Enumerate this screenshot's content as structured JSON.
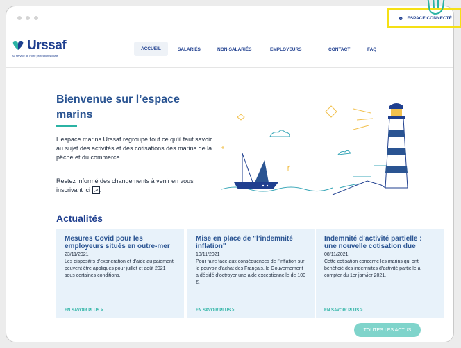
{
  "brand": {
    "name": "Urssaf",
    "tagline": "Au service de notre protection sociale"
  },
  "nav": {
    "items": [
      {
        "label": "ACCUEIL",
        "active": true
      },
      {
        "label": "SALARIÉS"
      },
      {
        "label": "NON-SALARIÉS"
      },
      {
        "label": "EMPLOYEURS"
      },
      {
        "label": "CONTACT"
      },
      {
        "label": "FAQ"
      }
    ],
    "espace": "ESPACE CONNECTÉ"
  },
  "hero": {
    "title": "Bienvenue sur l’espace marins",
    "intro": "L’espace marins Urssaf regroupe tout ce qu’il faut savoir au sujet des activités et des cotisations des marins de la pêche et du commerce.",
    "info_prefix": "Restez informé des changements à venir en vous ",
    "info_link": "inscrivant ici",
    "info_suffix": "."
  },
  "actus": {
    "title": "Actualités",
    "cards": [
      {
        "title": "Mesures Covid pour les employeurs situés en outre-mer",
        "date": "23/11/2021",
        "body": "Les dispositifs d’exonération et d’aide au paiement peuvent être appliqués pour juillet et août 2021 sous certaines conditions.",
        "link": "EN SAVOIR PLUS  >"
      },
      {
        "title": "Mise en place de \"l’indemnité inflation\"",
        "date": "10/11/2021",
        "body": "Pour faire face aux conséquences de l’inflation sur le pouvoir d’achat des Français, le Gouvernement a décidé d’octroyer une aide exceptionnelle de 100 €.",
        "link": "EN SAVOIR PLUS  >"
      },
      {
        "title": "Indemnité d’activité partielle : une nouvelle cotisation due",
        "date": "08/11/2021",
        "body": "Cette cotisation concerne les marins qui ont bénéficié des indemnités d’activité partielle à compter du 1er janvier 2021.",
        "link": "EN SAVOIR PLUS  >"
      }
    ],
    "all_button": "TOUTES LES ACTUS"
  },
  "colors": {
    "primary": "#1f3f8f",
    "accent": "#2bb3a4",
    "highlight": "#f5e015",
    "card_bg": "#e8f2fa"
  }
}
